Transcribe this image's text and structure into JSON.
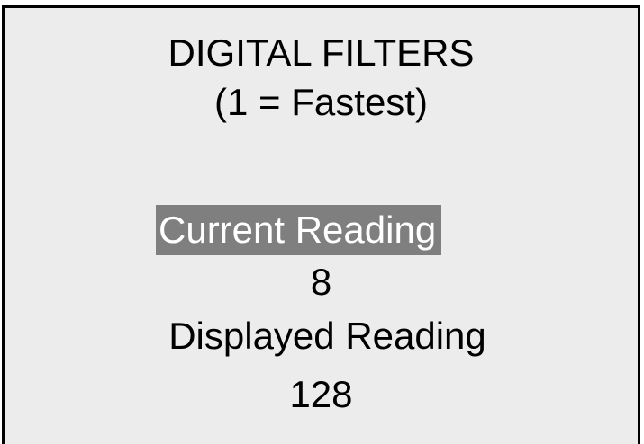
{
  "screen": {
    "title": "DIGITAL FILTERS",
    "subtitle": "(1 = Fastest)",
    "menu": [
      {
        "label": "Current Reading",
        "value": "8",
        "selected": true
      },
      {
        "label": "Displayed Reading",
        "value": "128",
        "selected": false
      }
    ]
  },
  "colors": {
    "screen_background": "#ececec",
    "highlight_background": "#7f7f7f",
    "highlight_text": "#ffffff",
    "text": "#000000",
    "border": "#000000"
  }
}
